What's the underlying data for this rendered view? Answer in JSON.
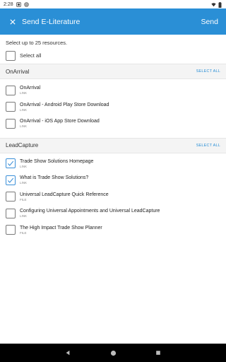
{
  "status_bar": {
    "time": "2:28"
  },
  "app_bar": {
    "title": "Send E-Literature",
    "send_label": "Send"
  },
  "intro_text": "Select up to 25 resources.",
  "select_all_label": "Select all",
  "sections": [
    {
      "title": "OnArrival",
      "select_all": "SELECT ALL",
      "items": [
        {
          "title": "OnArrival",
          "type": "LINK",
          "checked": false
        },
        {
          "title": "OnArrival - Android Play Store Download",
          "type": "LINK",
          "checked": false
        },
        {
          "title": "OnArrival - iOS App Store Download",
          "type": "LINK",
          "checked": false
        }
      ]
    },
    {
      "title": "LeadCapture",
      "select_all": "SELECT ALL",
      "items": [
        {
          "title": "Trade Show Solutions Homepage",
          "type": "LINK",
          "checked": true
        },
        {
          "title": "What is Trade Show Solutions?",
          "type": "LINK",
          "checked": true
        },
        {
          "title": "Universal LeadCapture Quick Reference",
          "type": "FILE",
          "checked": false
        },
        {
          "title": "Configuring Universal Appointments and Universal LeadCapture",
          "type": "LINK",
          "checked": false
        },
        {
          "title": "The High Impact Trade Show Planner",
          "type": "FILE",
          "checked": false
        }
      ]
    }
  ],
  "colors": {
    "accent": "#2a8fd6",
    "check": "#3b8fd8"
  }
}
